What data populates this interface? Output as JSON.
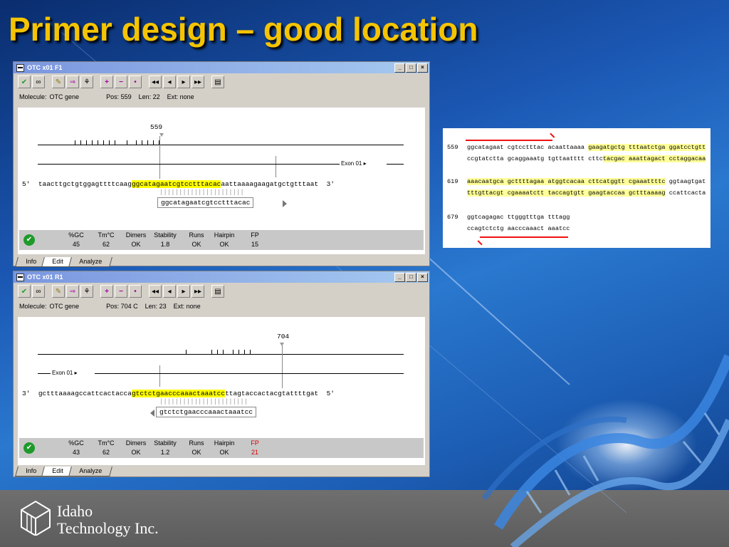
{
  "slide": {
    "title": "Primer design – good location"
  },
  "logo": {
    "line1": "Idaho",
    "line2": "Technology Inc."
  },
  "windows": [
    {
      "title": "OTC x01 F1",
      "info": {
        "molecule_label": "Molecule:",
        "molecule": "OTC gene",
        "pos": "Pos: 559",
        "len": "Len: 22",
        "ext": "Ext: none"
      },
      "marker": "559",
      "exon_label": "Exon 01",
      "strand_left": "5'",
      "strand_right": "3'",
      "seq_pre": "taacttgctgtggagttttcaag",
      "seq_hl": "ggcatagaatcgtcctttacac",
      "seq_post": "aattaaaagaagatgctgtttaat",
      "primer": "ggcatagaatcgtcctttacac",
      "stats": {
        "headers": [
          "%GC",
          "Tm°C",
          "Dimers",
          "Stability",
          "Runs",
          "Hairpin",
          "FP"
        ],
        "values": [
          "45",
          "62",
          "OK",
          "1.8",
          "OK",
          "OK",
          "15"
        ]
      },
      "tabs": [
        "Info",
        "Edit",
        "Analyze"
      ]
    },
    {
      "title": "OTC x01 R1",
      "info": {
        "molecule_label": "Molecule:",
        "molecule": "OTC gene",
        "pos": "Pos: 704 C",
        "len": "Len: 23",
        "ext": "Ext: none"
      },
      "marker": "704",
      "exon_label": "Exon 01",
      "strand_left": "3'",
      "strand_right": "5'",
      "seq_pre": "gctttaaaagccattcactacca",
      "seq_hl": "gtctctgaacccaaactaaatcc",
      "seq_post": "ttagtaccactacgtattttgat",
      "primer": "gtctctgaacccaaactaaatcc",
      "stats": {
        "headers": [
          "%GC",
          "Tm°C",
          "Dimers",
          "Stability",
          "Runs",
          "Hairpin",
          "FP"
        ],
        "values": [
          "43",
          "62",
          "OK",
          "1.2",
          "OK",
          "OK",
          "21"
        ]
      },
      "tabs": [
        "Info",
        "Edit",
        "Analyze"
      ]
    }
  ],
  "sequence_panel": {
    "rows": [
      {
        "num": "559",
        "top": [
          "ggcatagaat",
          "cgtcctttac",
          "acaattaaaa",
          "gaag",
          "atgctg",
          "tttaatctga",
          "ggatcctgtt"
        ],
        "bottom": [
          "ccgtatctta",
          "gcaggaaatg",
          "tgttaatttt",
          "cttc",
          "tacgac",
          "aaattagact",
          "cctaggacaa"
        ]
      },
      {
        "num": "619",
        "top": [
          "aaacaatgca",
          "gcttttagaa",
          "atggtcacaa",
          "cttcatggtt",
          "cgaaattttc",
          "ggtaagtgat"
        ],
        "bottom": [
          "tttgttacgt",
          "cgaaaatctt",
          "taccagtgtt",
          "gaagtaccaa",
          "gctttaaaag",
          "ccattcacta"
        ]
      },
      {
        "num": "679",
        "top": [
          "ggtcagagac",
          "ttgggtttga",
          "tttagg"
        ],
        "bottom": [
          "ccagtctctg",
          "aacccaaact",
          "aaatcc"
        ]
      }
    ]
  }
}
